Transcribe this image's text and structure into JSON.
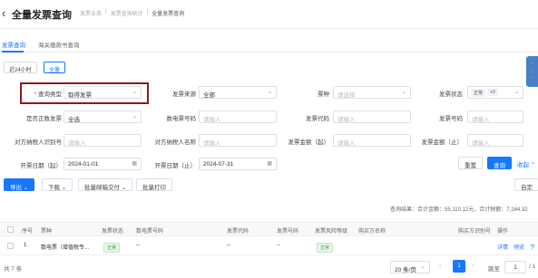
{
  "header": {
    "back_icon": "arrow-left-icon",
    "title": "全量发票查询",
    "breadcrumb": [
      "发票业务",
      "发票查询统计",
      "全量发票查询"
    ]
  },
  "tabs": [
    {
      "label": "发票查询",
      "active": true
    },
    {
      "label": "海关缴款书查询",
      "active": false
    }
  ],
  "time_range": [
    {
      "label": "近24小时",
      "active": false
    },
    {
      "label": "全量",
      "active": true
    }
  ],
  "filters": {
    "query_type": {
      "label": "查询类型",
      "value": "取得发票"
    },
    "invoice_source": {
      "label": "发票来源",
      "value": "全部"
    },
    "invoice_kind": {
      "label": "票种",
      "placeholder": "请选择"
    },
    "invoice_status": {
      "label": "发票状态",
      "tags": [
        "正常",
        "+3"
      ]
    },
    "is_positive": {
      "label": "是否正数发票",
      "value": "全选"
    },
    "digital_no": {
      "label": "数电票号码",
      "placeholder": "请输入"
    },
    "invoice_code": {
      "label": "发票代码",
      "placeholder": "请输入"
    },
    "invoice_no": {
      "label": "发票号码",
      "placeholder": "请输入"
    },
    "counterpart_tax_id": {
      "label": "对方纳税人识别号",
      "placeholder": "请输入"
    },
    "counterpart_name": {
      "label": "对方纳税人名称",
      "placeholder": "请输入"
    },
    "amount_from": {
      "label": "发票金额（起）",
      "placeholder": "请输入"
    },
    "amount_to": {
      "label": "发票金额（止）",
      "placeholder": "请输入"
    },
    "date_from": {
      "label": "开票日期（起）",
      "value": "2024-01-01"
    },
    "date_to": {
      "label": "开票日期（止）",
      "value": "2024-07-31"
    }
  },
  "actions": {
    "reset": "重置",
    "search": "查询",
    "collapse": "收起",
    "export": "导出",
    "download": "下载",
    "batch_mail": "批量邮箱交付",
    "batch_print": "批量打印",
    "custom": "自定"
  },
  "summary": "查询结果：合计金额：55,110.12元，合计税额：7,164.32",
  "table": {
    "headers": [
      "序号",
      "票种",
      "发票状态",
      "数电票号码",
      "发票代码",
      "发票号码",
      "发票风险等级",
      "购买方名称",
      "购买方识别号",
      "操作"
    ],
    "rows": [
      {
        "no": "1",
        "kind": "数电票（增值税专...",
        "status": "正常",
        "digital_no": "--",
        "code": "--",
        "number": "--",
        "risk": "正常",
        "buyer": "",
        "buyer_id": "",
        "ops": [
          "详情",
          "预览",
          "下"
        ]
      }
    ]
  },
  "pagination": {
    "total": "共 7 条",
    "page_size": "20 条/页",
    "current_page": "1",
    "goto_label": "跳至",
    "goto_value": "1",
    "total_pages": "/ 1"
  },
  "colors": {
    "primary": "#1677ff",
    "highlight_border": "#8b1a1a",
    "tag_green": "#52c41a"
  }
}
